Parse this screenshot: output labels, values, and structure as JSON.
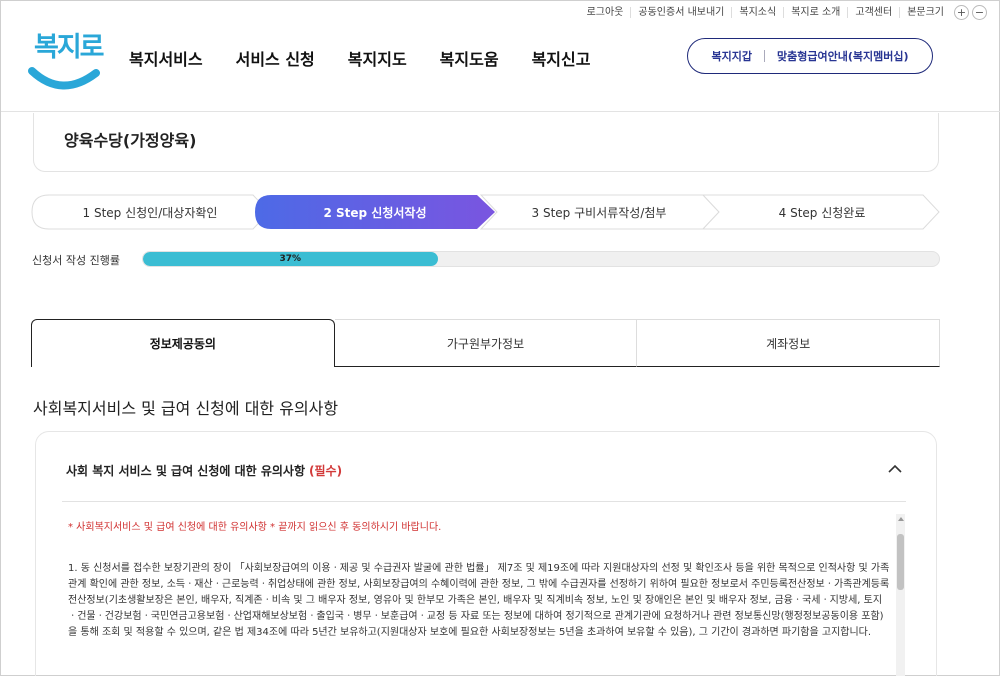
{
  "utility": {
    "links": [
      "로그아웃",
      "공동인증서 내보내기",
      "복지소식",
      "복지로 소개",
      "고객센터",
      "본문크기"
    ],
    "zoom_in": "+",
    "zoom_out": "−"
  },
  "logo": {
    "text": "복지로"
  },
  "nav": {
    "items": [
      "복지서비스",
      "서비스 신청",
      "복지지도",
      "복지도움",
      "복지신고"
    ]
  },
  "header_pill": {
    "left": "복지지갑",
    "right": "맞춤형급여안내(복지멤버십)"
  },
  "program": {
    "title": "양육수당(가정양육)"
  },
  "steps": [
    {
      "label": "1 Step 신청인/대상자확인",
      "active": false
    },
    {
      "label": "2 Step 신청서작성",
      "active": true
    },
    {
      "label": "3 Step 구비서류작성/첨부",
      "active": false
    },
    {
      "label": "4 Step 신청완료",
      "active": false
    }
  ],
  "progress": {
    "label": "신청서 작성 진행률",
    "value": 37,
    "text": "37%"
  },
  "tabs": [
    "정보제공동의",
    "가구원부가정보",
    "계좌정보"
  ],
  "section": {
    "title": "사회복지서비스 및 급여 신청에 대한 유의사항"
  },
  "notice": {
    "heading": "사회 복지 서비스 및 급여 신청에 대한 유의사항",
    "required": "(필수)",
    "warning": "* 사회복지서비스 및 급여 신청에 대한 유의사항 * 끝까지 읽으신 후 동의하시기 바랍니다.",
    "body": "1. 동 신청서를 접수한 보장기관의 장이 「사회보장급여의 이용ㆍ제공 및 수급권자 발굴에 관한 법률」 제7조 및 제19조에 따라 지원대상자의 선정 및 확인조사 등을 위한 목적으로 인적사항 및 가족관계 확인에 관한 정보, 소득ㆍ재산ㆍ근로능력ㆍ취업상태에 관한 정보, 사회보장급여의 수혜이력에 관한 정보, 그 밖에 수급권자를 선정하기 위하여 필요한 정보로서 주민등록전산정보ㆍ가족관계등록전산정보(기초생활보장은 본인, 배우자, 직계존ㆍ비속 및 그 배우자 정보, 영유아 및 한부모 가족은 본인, 배우자 및 직계비속 정보, 노인 및 장애인은 본인 및 배우자 정보, 금융ㆍ국세ㆍ지방세, 토지ㆍ건물ㆍ건강보험ㆍ국민연금고용보험ㆍ산업재해보상보험ㆍ출입국ㆍ병무ㆍ보훈급여ㆍ교정 등 자료 또는 정보에 대하여 정기적으로 관계기관에 요청하거나 관련 정보통신망(행정정보공동이용 포함)을 통해 조회 및 적용할 수 있으며, 같은 법 제34조에 따라 5년간 보유하고(지원대상자 보호에 필요한 사회보장정보는 5년을 초과하여 보유할 수 있음), 그 기간이 경과하면 파기함을 고지합니다."
  },
  "colors": {
    "accent_step": "#5b62e6",
    "progress": "#3bbdd3",
    "required": "#d23a3a",
    "nav_pill": "#1f2a7a"
  }
}
